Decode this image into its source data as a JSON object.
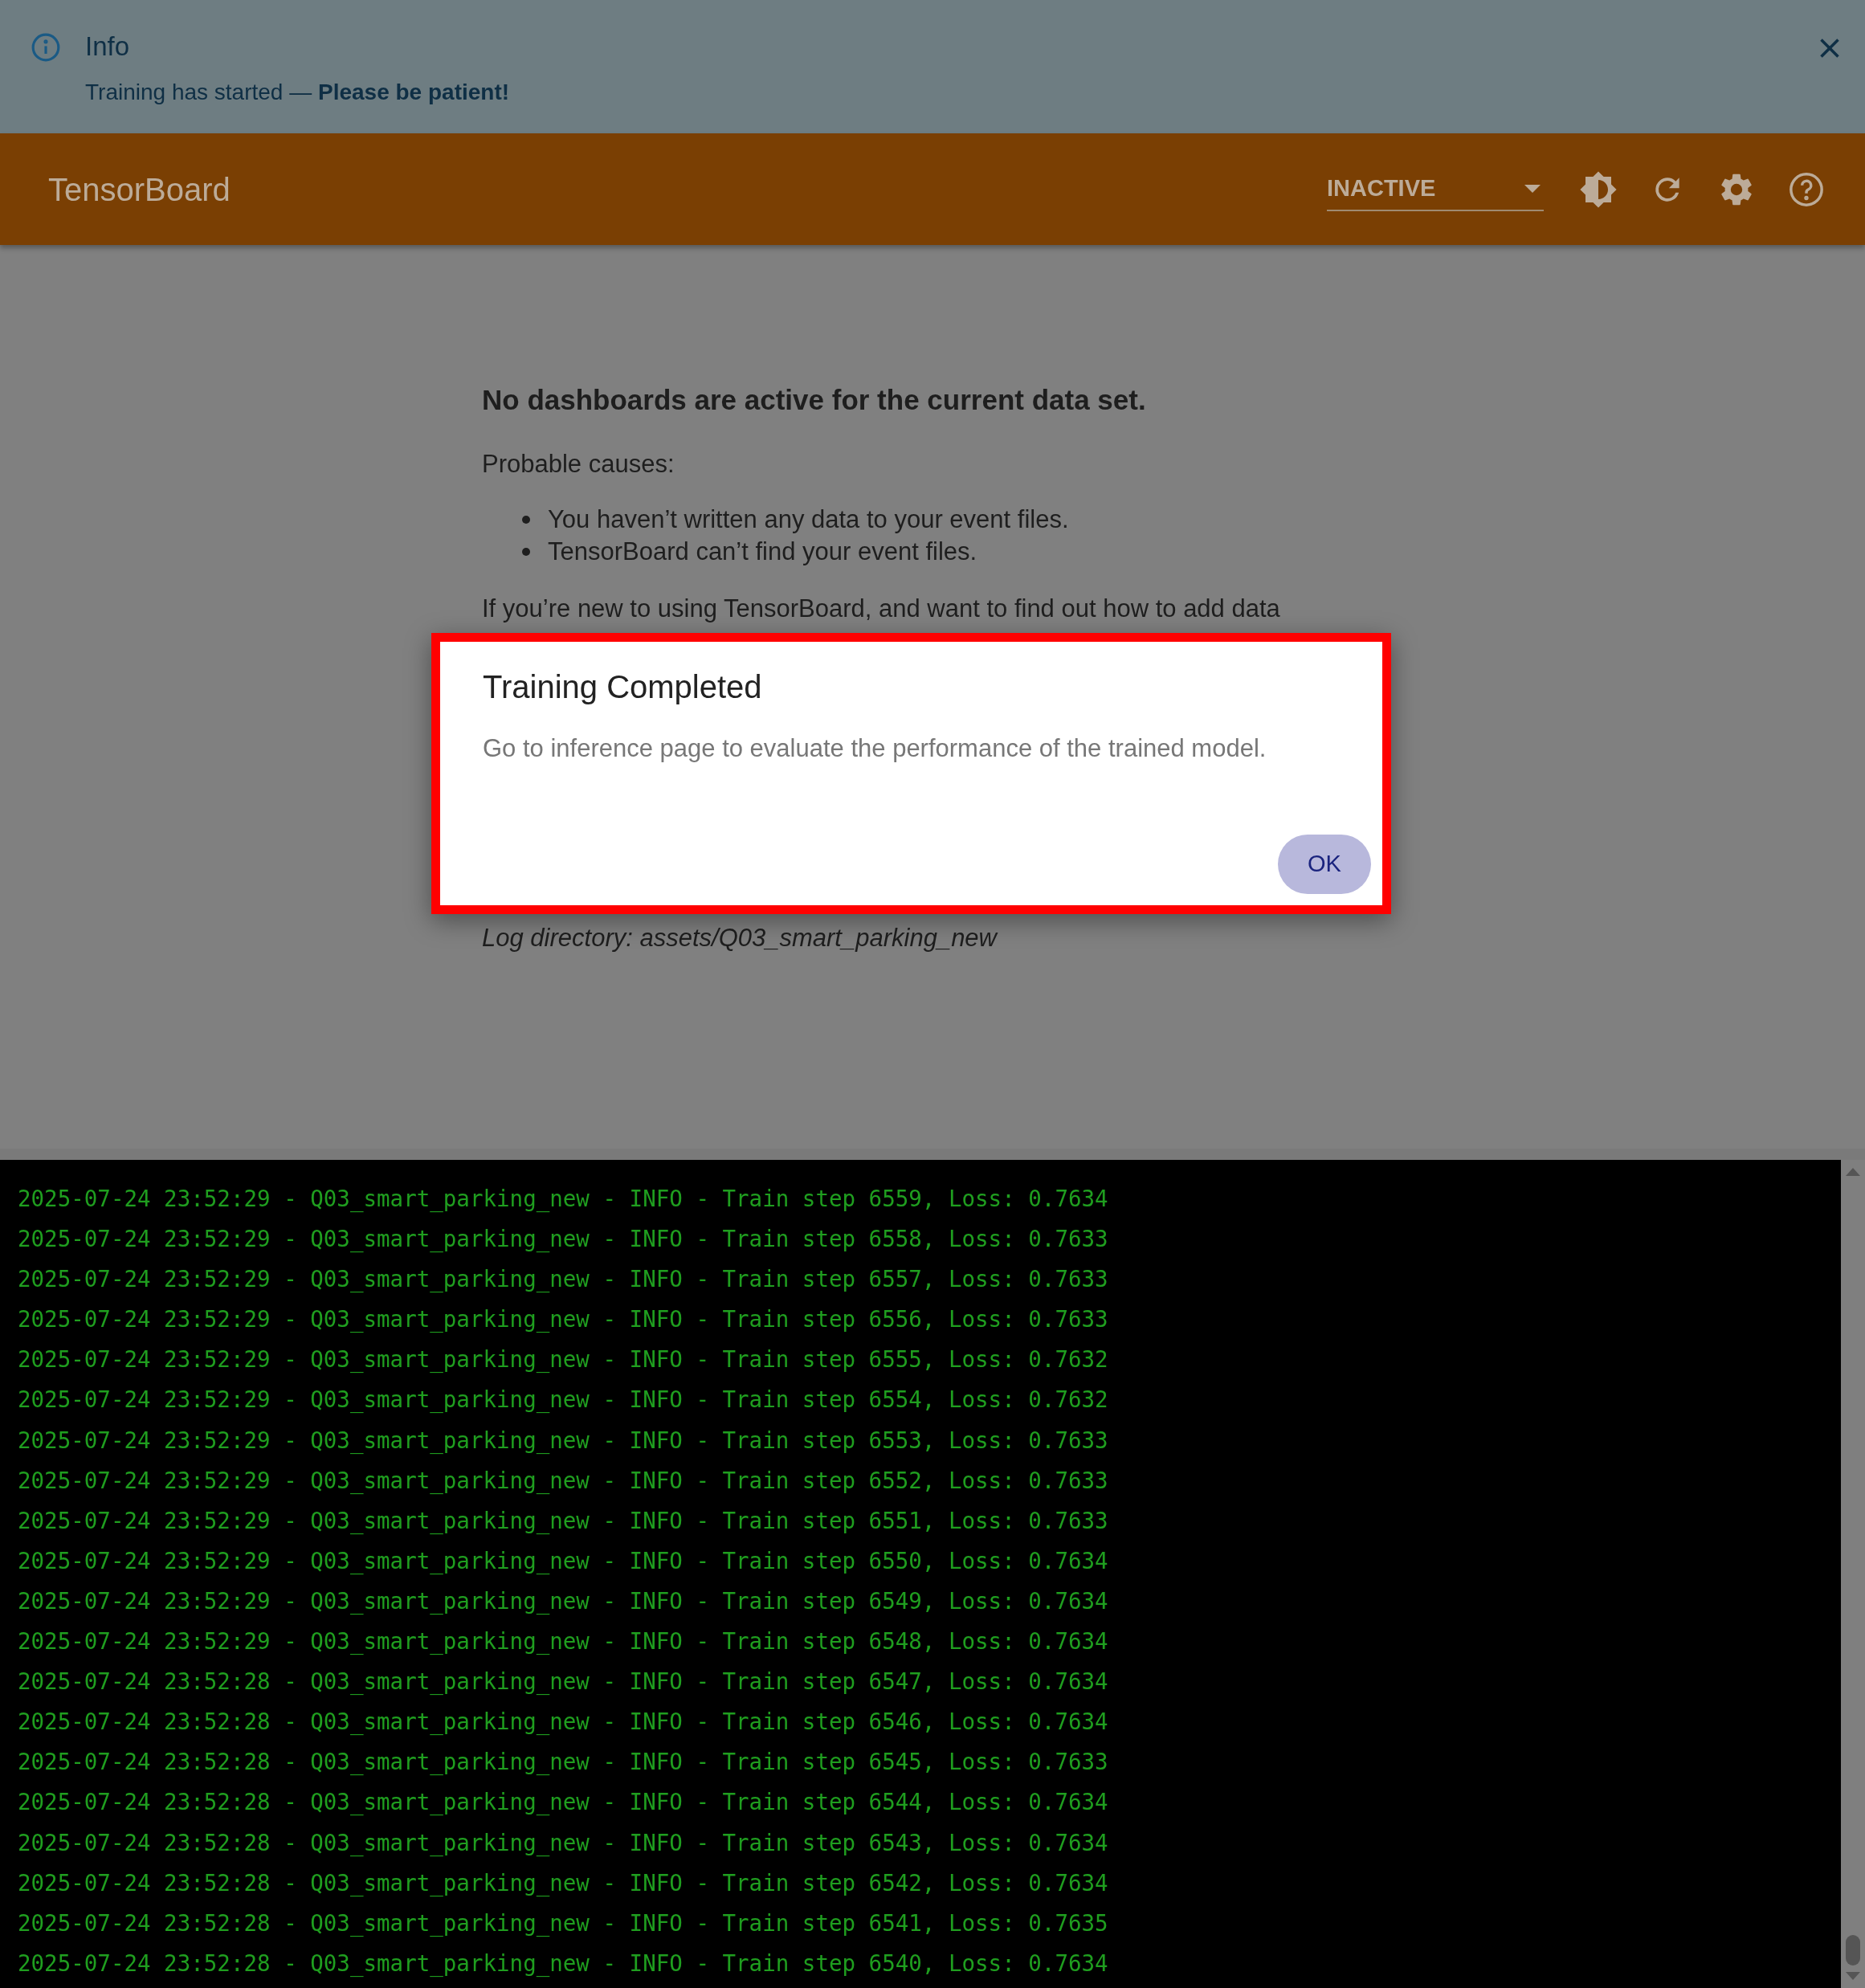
{
  "info_banner": {
    "title": "Info",
    "message": "Training has started — **Please be patient!**"
  },
  "toolbar": {
    "title": "TensorBoard",
    "dashboard_select": {
      "value": "INACTIVE"
    }
  },
  "empty_state": {
    "heading": "No dashboards are active for the current data set.",
    "causes_label": "Probable causes:",
    "causes": [
      "You haven’t written any data to your event files.",
      "TensorBoard can’t find your event files."
    ],
    "help_text": "If you’re new to using TensorBoard, and want to find out how to add data",
    "log_directory": "Log directory: assets/Q03_smart_parking_new"
  },
  "dialog": {
    "title": "Training Completed",
    "message": "Go to inference page to evaluate the performance of the trained model.",
    "button": "OK"
  },
  "log": {
    "lines": [
      "2025-07-24 23:52:29 - Q03_smart_parking_new - INFO - Train step 6559, Loss: 0.7634",
      "2025-07-24 23:52:29 - Q03_smart_parking_new - INFO - Train step 6558, Loss: 0.7633",
      "2025-07-24 23:52:29 - Q03_smart_parking_new - INFO - Train step 6557, Loss: 0.7633",
      "2025-07-24 23:52:29 - Q03_smart_parking_new - INFO - Train step 6556, Loss: 0.7633",
      "2025-07-24 23:52:29 - Q03_smart_parking_new - INFO - Train step 6555, Loss: 0.7632",
      "2025-07-24 23:52:29 - Q03_smart_parking_new - INFO - Train step 6554, Loss: 0.7632",
      "2025-07-24 23:52:29 - Q03_smart_parking_new - INFO - Train step 6553, Loss: 0.7633",
      "2025-07-24 23:52:29 - Q03_smart_parking_new - INFO - Train step 6552, Loss: 0.7633",
      "2025-07-24 23:52:29 - Q03_smart_parking_new - INFO - Train step 6551, Loss: 0.7633",
      "2025-07-24 23:52:29 - Q03_smart_parking_new - INFO - Train step 6550, Loss: 0.7634",
      "2025-07-24 23:52:29 - Q03_smart_parking_new - INFO - Train step 6549, Loss: 0.7634",
      "2025-07-24 23:52:29 - Q03_smart_parking_new - INFO - Train step 6548, Loss: 0.7634",
      "2025-07-24 23:52:28 - Q03_smart_parking_new - INFO - Train step 6547, Loss: 0.7634",
      "2025-07-24 23:52:28 - Q03_smart_parking_new - INFO - Train step 6546, Loss: 0.7634",
      "2025-07-24 23:52:28 - Q03_smart_parking_new - INFO - Train step 6545, Loss: 0.7633",
      "2025-07-24 23:52:28 - Q03_smart_parking_new - INFO - Train step 6544, Loss: 0.7634",
      "2025-07-24 23:52:28 - Q03_smart_parking_new - INFO - Train step 6543, Loss: 0.7634",
      "2025-07-24 23:52:28 - Q03_smart_parking_new - INFO - Train step 6542, Loss: 0.7634",
      "2025-07-24 23:52:28 - Q03_smart_parking_new - INFO - Train step 6541, Loss: 0.7635",
      "2025-07-24 23:52:28 - Q03_smart_parking_new - INFO - Train step 6540, Loss: 0.7634"
    ]
  }
}
